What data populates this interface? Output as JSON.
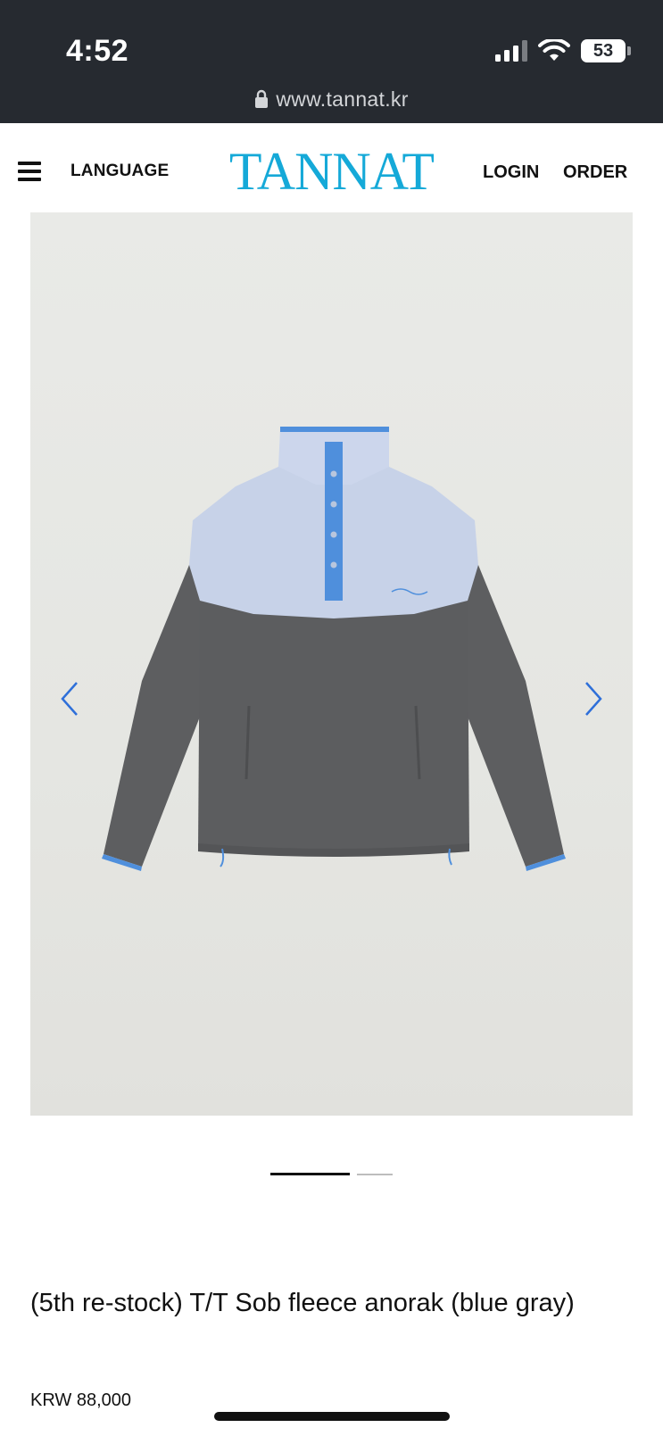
{
  "status_bar": {
    "time": "4:52",
    "battery": "53"
  },
  "browser": {
    "url": "www.tannat.kr"
  },
  "header": {
    "language_label": "LANGUAGE",
    "logo": "TANNAT",
    "login_label": "LOGIN",
    "order_label": "ORDER"
  },
  "gallery": {
    "active_index": 0,
    "slide_count": 2
  },
  "product": {
    "title": "(5th re-stock) T/T Sob fleece anorak (blue gray)",
    "price": "KRW 88,000"
  },
  "colors": {
    "brand": "#15a9d8",
    "chrome": "#262a30",
    "jacket_body": "#5c5d5f",
    "jacket_yoke": "#c7d2e8",
    "jacket_trim": "#4f8fdc"
  }
}
